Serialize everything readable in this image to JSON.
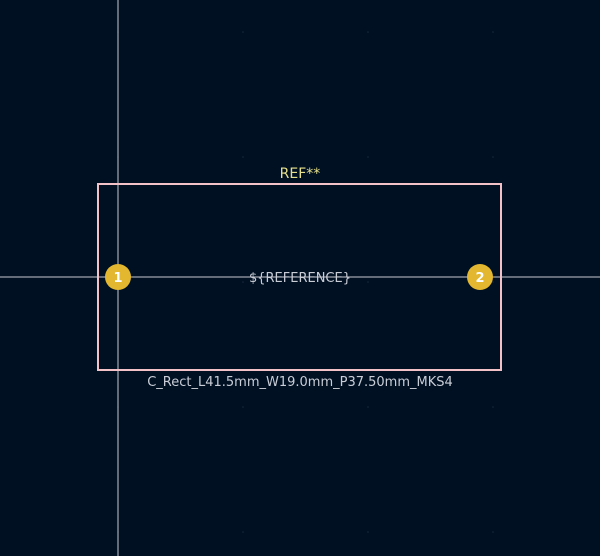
{
  "editor": {
    "colors": {
      "background": "#001023",
      "crosshair": "#c8c8d2",
      "courtyard": "#f2c2c8",
      "pad": "#e3b72f",
      "pad_text": "#ffffff",
      "ref_text": "#e6e08a",
      "value_text": "#c9cdd6",
      "grid_dot": "#1a2a3c"
    },
    "footprint": {
      "reference": "REF**",
      "value": "C_Rect_L41.5mm_W19.0mm_P37.50mm_MKS4",
      "fab_reference": "${REFERENCE}",
      "pads": [
        {
          "number": "1"
        },
        {
          "number": "2"
        }
      ]
    }
  }
}
